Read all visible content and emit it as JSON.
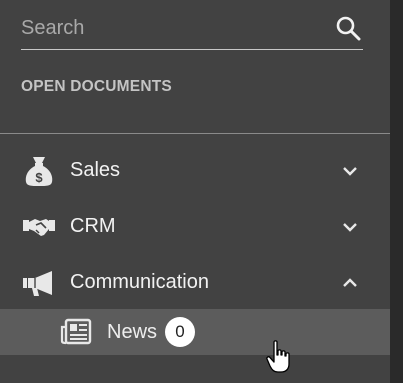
{
  "search": {
    "placeholder": "Search",
    "icon": "search-icon"
  },
  "section": {
    "title": "OPEN DOCUMENTS"
  },
  "menu": {
    "items": [
      {
        "label": "Sales",
        "icon": "money-bag-icon",
        "expanded": false
      },
      {
        "label": "CRM",
        "icon": "handshake-icon",
        "expanded": false
      },
      {
        "label": "Communication",
        "icon": "megaphone-icon",
        "expanded": true
      }
    ],
    "subitems": [
      {
        "label": "News",
        "icon": "newspaper-icon",
        "count": "0"
      }
    ]
  },
  "colors": {
    "panel": "#424242",
    "highlight": "#5c5c5c",
    "text": "#f2f2f2",
    "badge": "#ffffff"
  }
}
